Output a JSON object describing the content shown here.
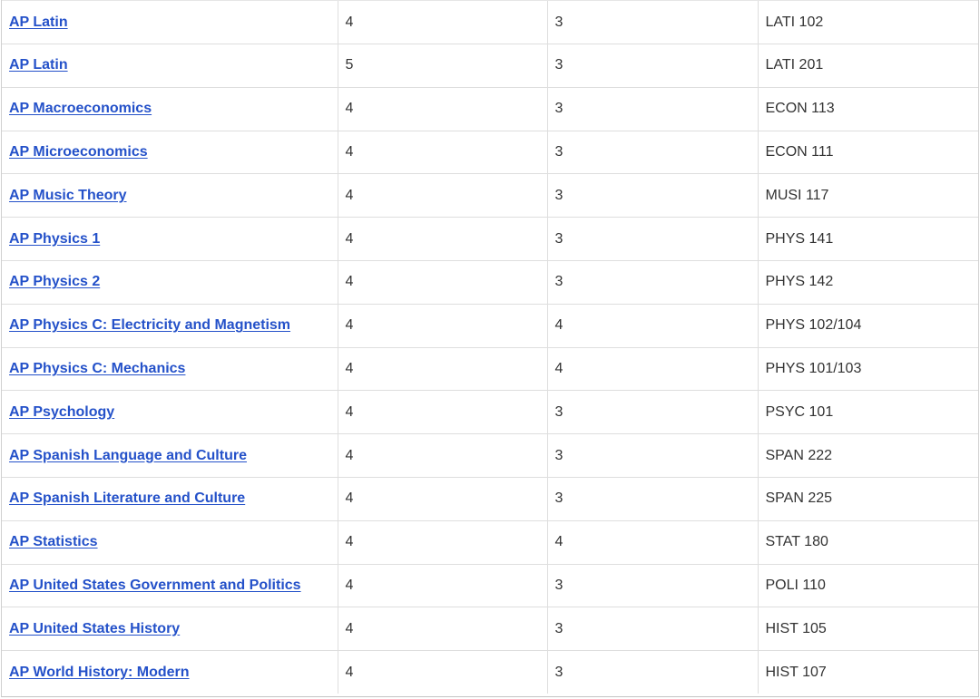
{
  "rows": [
    {
      "exam": "AP Latin",
      "score": "4",
      "credits": "3",
      "equivalent": "LATI 102"
    },
    {
      "exam": "AP Latin",
      "score": "5",
      "credits": "3",
      "equivalent": "LATI 201"
    },
    {
      "exam": "AP Macroeconomics",
      "score": "4",
      "credits": "3",
      "equivalent": "ECON 113"
    },
    {
      "exam": "AP Microeconomics",
      "score": "4",
      "credits": "3",
      "equivalent": "ECON 111"
    },
    {
      "exam": "AP Music Theory",
      "score": "4",
      "credits": "3",
      "equivalent": "MUSI 117"
    },
    {
      "exam": "AP Physics 1",
      "score": "4",
      "credits": "3",
      "equivalent": "PHYS 141"
    },
    {
      "exam": "AP Physics 2",
      "score": "4",
      "credits": "3",
      "equivalent": "PHYS 142"
    },
    {
      "exam": "AP Physics C: Electricity and Magnetism",
      "score": "4",
      "credits": "4",
      "equivalent": "PHYS 102/104"
    },
    {
      "exam": "AP Physics C: Mechanics",
      "score": "4",
      "credits": "4",
      "equivalent": "PHYS 101/103"
    },
    {
      "exam": "AP Psychology",
      "score": "4",
      "credits": "3",
      "equivalent": "PSYC 101"
    },
    {
      "exam": "AP Spanish Language and Culture",
      "score": "4",
      "credits": "3",
      "equivalent": "SPAN 222"
    },
    {
      "exam": "AP Spanish Literature and Culture",
      "score": "4",
      "credits": "3",
      "equivalent": "SPAN 225"
    },
    {
      "exam": "AP Statistics",
      "score": "4",
      "credits": "4",
      "equivalent": "STAT 180"
    },
    {
      "exam": "AP United States Government and Politics",
      "score": "4",
      "credits": "3",
      "equivalent": "POLI 110"
    },
    {
      "exam": "AP United States History",
      "score": "4",
      "credits": "3",
      "equivalent": "HIST 105"
    },
    {
      "exam": "AP World History: Modern",
      "score": "4",
      "credits": "3",
      "equivalent": "HIST 107"
    }
  ],
  "colors": {
    "link": "#2451c9",
    "text": "#333333",
    "border": "#dedede"
  }
}
